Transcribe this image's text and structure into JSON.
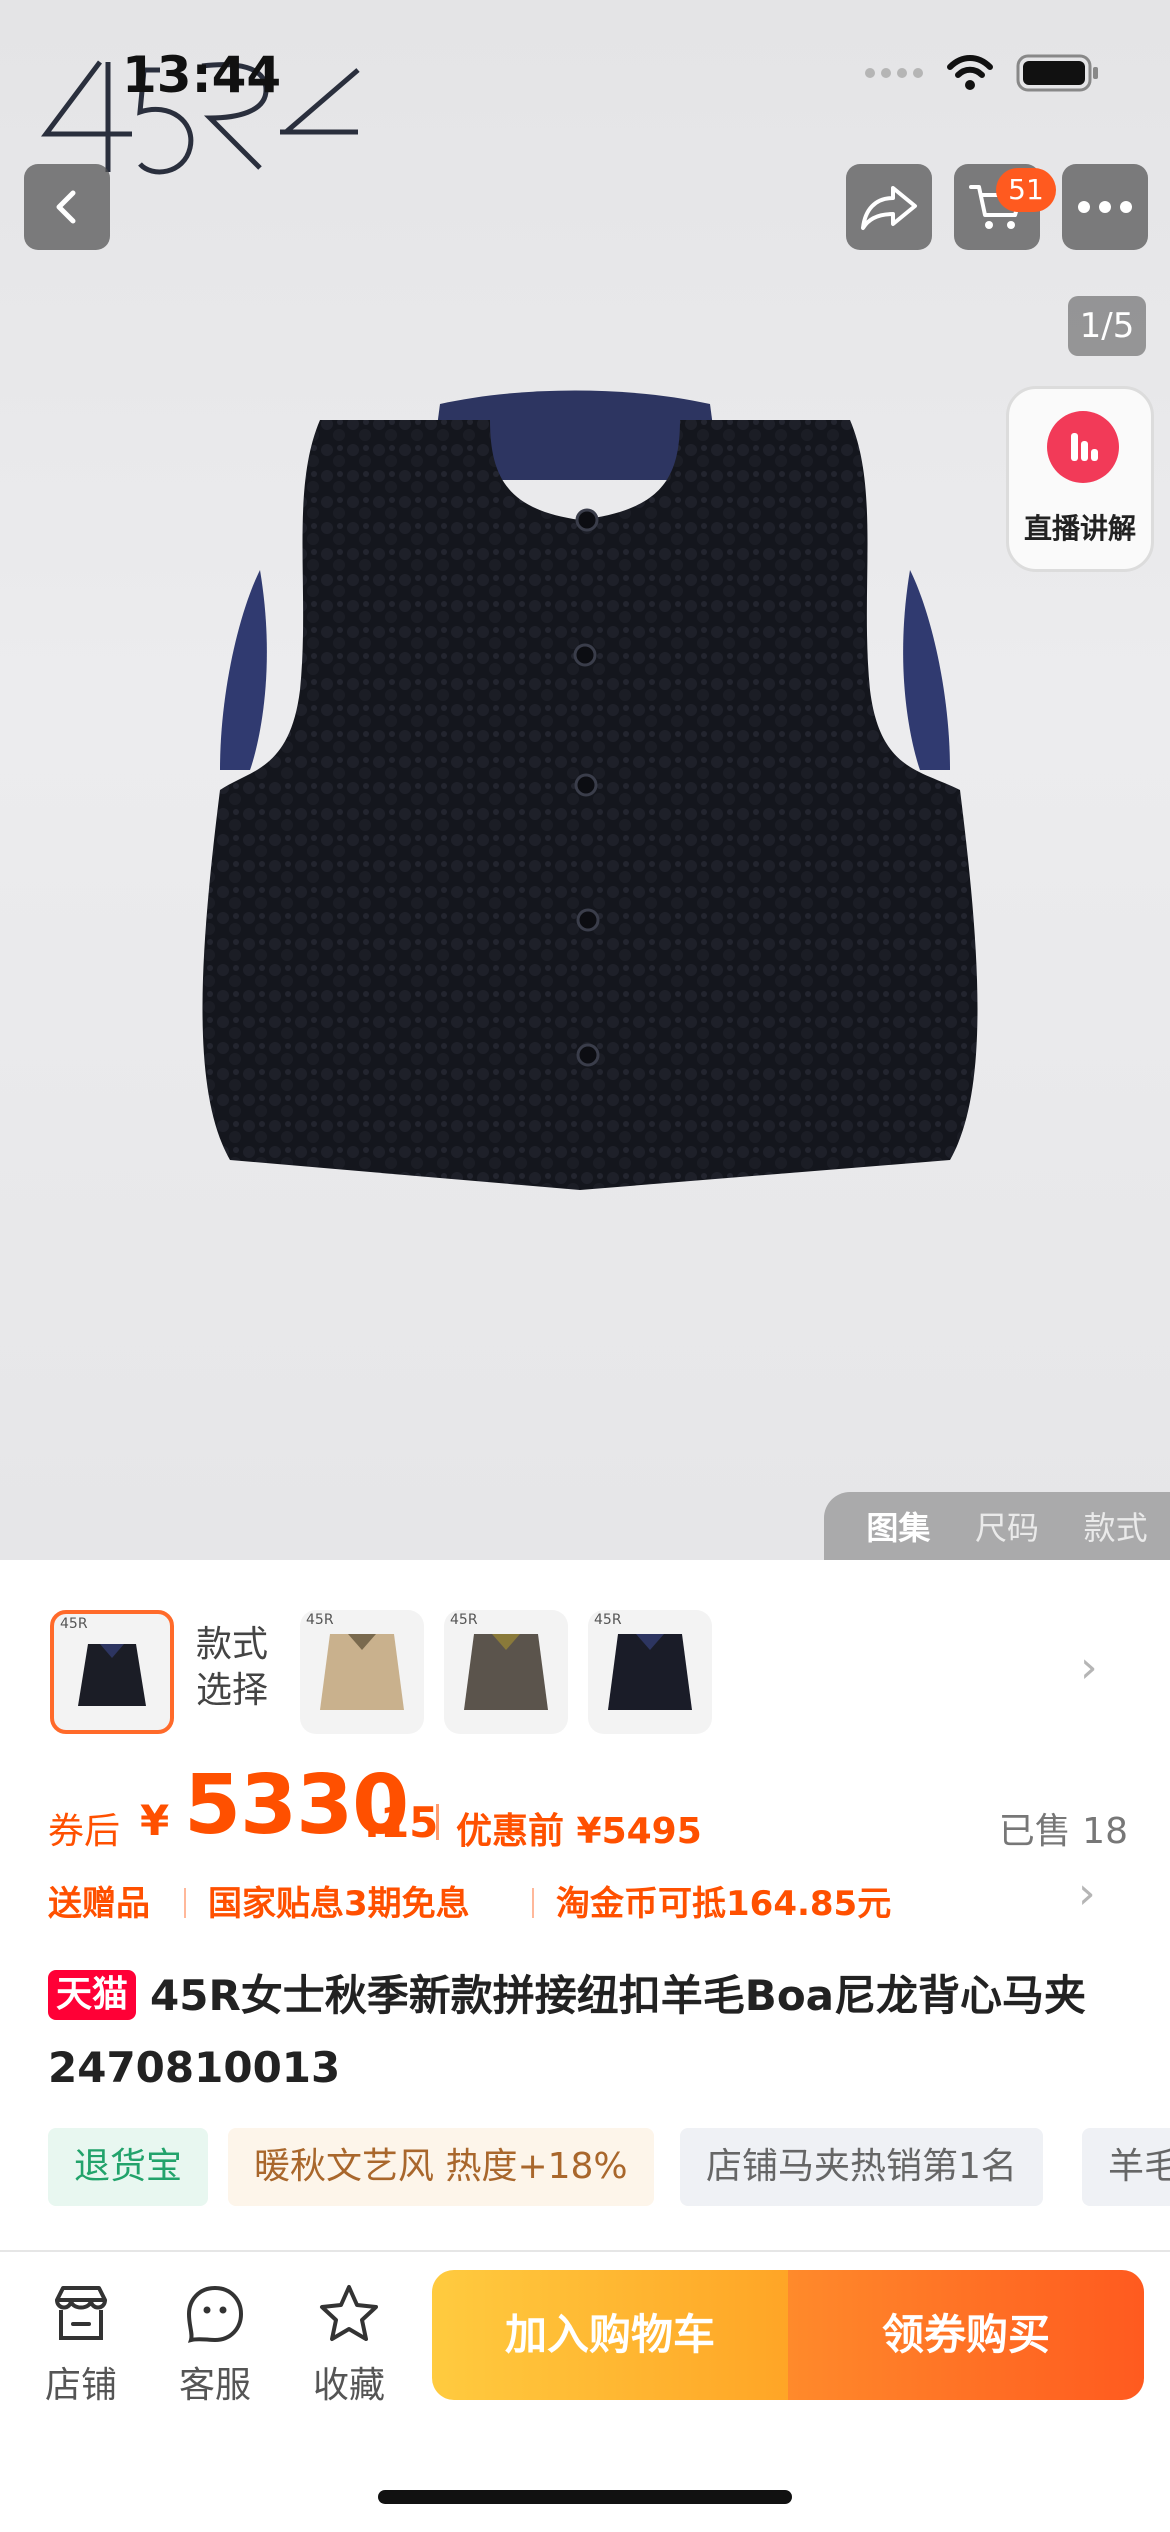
{
  "status_bar": {
    "time": "13:44"
  },
  "hero": {
    "brand_logo_text": "45R",
    "cart_count": "51",
    "page_counter": "1/5",
    "live": {
      "label": "直播讲解"
    },
    "gallery_tabs": [
      "图集",
      "尺码",
      "款式"
    ]
  },
  "style_picker": {
    "label_line1": "款式",
    "label_line2": "选择",
    "thumb_logo": "45R"
  },
  "price": {
    "prefix": "券后",
    "currency": "¥",
    "main": "5330",
    "decimal": ".15",
    "before_label": "优惠前 ¥5495",
    "sold": "已售 18"
  },
  "promos": [
    "送赠品",
    "国家贴息3期免息",
    "淘金币可抵164.85元"
  ],
  "product": {
    "platform_tag": "天猫",
    "title": "45R女士秋季新款拼接纽扣羊毛Boa尼龙背心马夹2470810013"
  },
  "tags": [
    "退货宝",
    "暖秋文艺风 热度+18%",
    "店铺马夹热销第1名",
    "羊毛"
  ],
  "bottom_nav": {
    "store": "店铺",
    "service": "客服",
    "favorite": "收藏",
    "add_to_cart": "加入购物车",
    "buy": "领券购买"
  },
  "colors": {
    "accent": "#ff5000",
    "tmall_red": "#ff0036",
    "cart_yellow": "#ffb52e",
    "buy_orange": "#ff6a24"
  }
}
